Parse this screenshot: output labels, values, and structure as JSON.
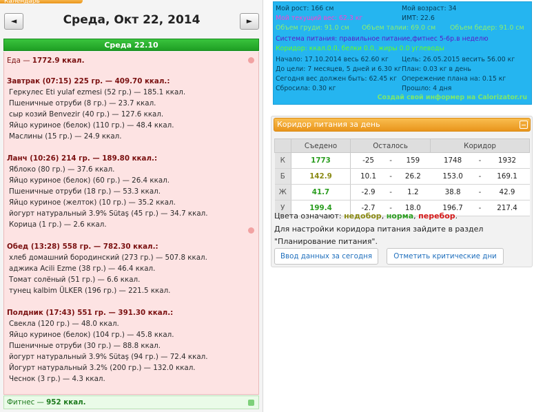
{
  "calendar": {
    "tab_label": "Календарь",
    "date_title": "Среда, Окт 22, 2014",
    "prev_label": "◄",
    "next_label": "►",
    "day_header": "Среда 22.10"
  },
  "diary": {
    "food_total_label": "Еда — ",
    "food_total_value": "1772.9 ккал.",
    "meals": [
      {
        "title": "Завтрак (07:15) 225 гр. — 409.70 ккал.:",
        "items": [
          "Геркулес Eti yulaf ezmesi (52 гр.) — 185.1 ккал.",
          "Пшеничные отруби (8 гр.) — 23.7 ккал.",
          "сыр козий Benvezir (40 гр.) — 127.6 ккал.",
          "Яйцо куриное (белок) (110 гр.) — 48.4 ккал.",
          "Маслины (15 гр.) — 24.9 ккал."
        ]
      },
      {
        "title": "Ланч (10:26) 214 гр. — 189.80 ккал.:",
        "items": [
          "Яблоко (80 гр.) — 37.6 ккал.",
          "Яйцо куриное (белок) (60 гр.) — 26.4 ккал.",
          "Пшеничные отруби (18 гр.) — 53.3 ккал.",
          "Яйцо куриное (желток) (10 гр.) — 35.2 ккал.",
          "йогурт натуральный 3.9% Sütaş (45 гр.) — 34.7 ккал.",
          "Корица (1 гр.) — 2.6 ккал."
        ]
      },
      {
        "title": "Обед (13:28) 558 гр. — 782.30 ккал.:",
        "items": [
          "хлеб домашний бородинский (273 гр.) — 507.8 ккал.",
          "аджика Acili Ezme (38 гр.) — 46.4 ккал.",
          "Томат солёный (51 гр.) — 6.6 ккал.",
          "тунец kalbim ÜLKER (196 гр.) — 221.5 ккал."
        ]
      },
      {
        "title": "Полдник (17:43) 551 гр. — 391.30 ккал.:",
        "items": [
          "Свекла (120 гр.) — 48.0 ккал.",
          "Яйцо куриное (белок) (104 гр.) — 45.8 ккал.",
          "Пшеничные отруби (30 гр.) — 88.8 ккал.",
          "йогурт натуральный 3.9% Sütaş (94 гр.) — 72.4 ккал.",
          "Йогурт натуральный 3.2% (200 гр.) — 132.0 ккал.",
          "Чеснок (3 гр.) — 4.3 ккал."
        ]
      }
    ],
    "fitness_label": "Фитнес — ",
    "fitness_value": "952 ккал."
  },
  "profile": {
    "height": "Мой рост: 166 см",
    "age": "Мой возраст: 34",
    "weight": "Мой текущий вес: 62.3 кг",
    "bmi": "ИМТ: 22.6",
    "chest": "Объем груди: 91.0 см",
    "waist": "Объем талии: 69.0 см",
    "hips": "Объем бедер: 91.0 см",
    "system": "Система питания: правильное питание,фитнес 5-6р.в неделю",
    "corridor_line": "Коридор: ккал.0.0, белки 0.0, жиры 0.0 углеводы",
    "start": "Начало: 17.10.2014 весь 62.60 кг",
    "goal": "Цель: 26.05.2015 весить 56.00 кг",
    "until_goal": "До цели: 7 месяцев, 5 дней и 6.30 кг",
    "plan": "План: 0.03 кг в день",
    "today_should": "Сегодня вес должен быть: 62.45 кг",
    "ahead": "Опережение плана на: 0.15 кг",
    "lost": "Сбросила: 0.30 кг",
    "passed": "Прошло: 4 дня",
    "link": "Создай свой информер на Calorizator.ru"
  },
  "corridor": {
    "header": "Коридор питания за день",
    "columns": [
      "Съедено",
      "Осталось",
      "Коридор"
    ],
    "rows": [
      {
        "label": "К",
        "eaten": "1773",
        "status": "norma",
        "left_a": "-25",
        "left_b": "159",
        "corr_a": "1748",
        "corr_b": "1932"
      },
      {
        "label": "Б",
        "eaten": "142.9",
        "status": "nedobor",
        "left_a": "10.1",
        "left_b": "26.2",
        "corr_a": "153.0",
        "corr_b": "169.1"
      },
      {
        "label": "Ж",
        "eaten": "41.7",
        "status": "norma",
        "left_a": "-2.9",
        "left_b": "1.2",
        "corr_a": "38.8",
        "corr_b": "42.9"
      },
      {
        "label": "У",
        "eaten": "199.4",
        "status": "norma",
        "left_a": "-2.7",
        "left_b": "18.0",
        "corr_a": "196.7",
        "corr_b": "217.4"
      }
    ],
    "dash": "-",
    "legend_prefix": "Цвета означают: ",
    "legend_nedobor": "недобор",
    "legend_sep1": ", ",
    "legend_norma": "норма",
    "legend_sep2": ", ",
    "legend_perebor": "перебор",
    "legend_end": ".",
    "info_line1": "Для настройки коридора питания зайдите в раздел",
    "info_line2": "\"Планирование питания\".",
    "btn_input": "Ввод данных за сегодня",
    "btn_critical": "Отметить критические дни",
    "colors": {
      "norma": "#2a9d1f",
      "nedobor": "#8a8a14",
      "perebor": "#d51818"
    }
  }
}
